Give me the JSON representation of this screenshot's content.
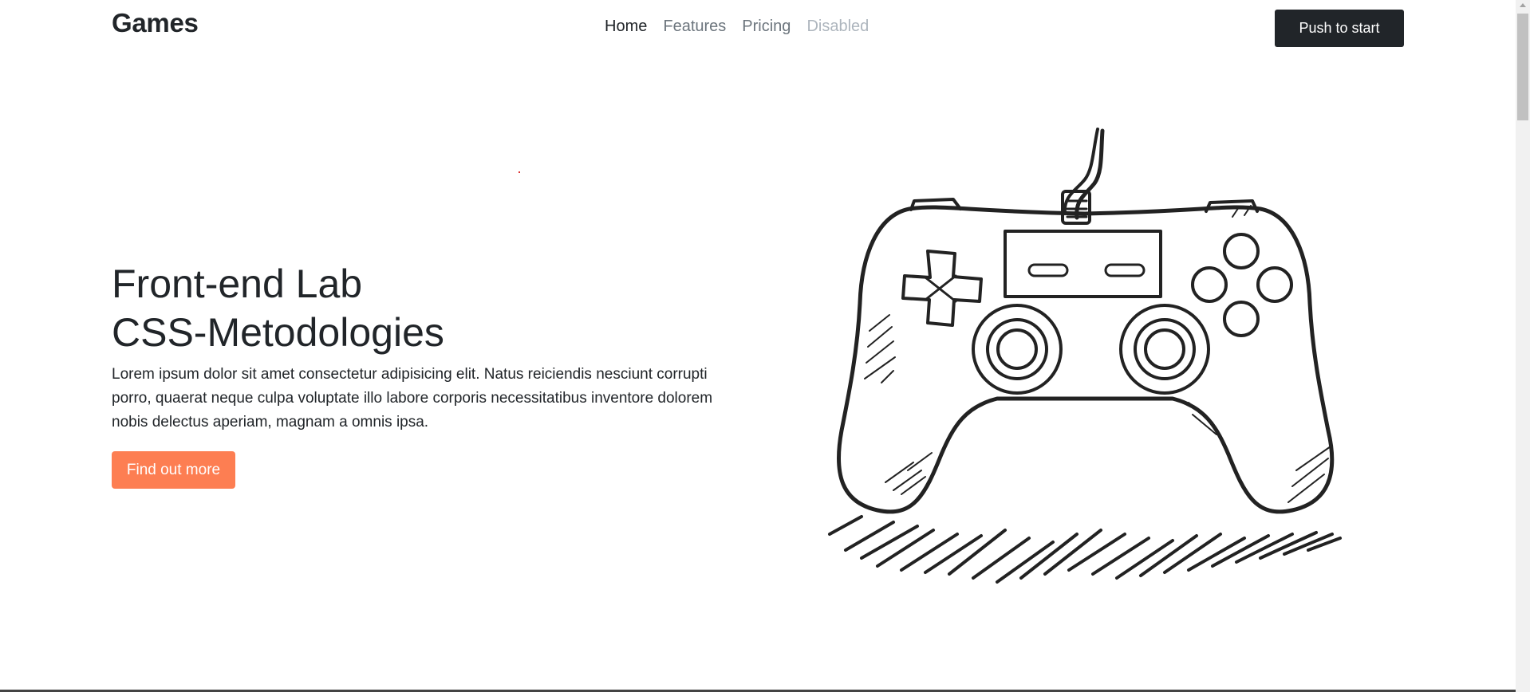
{
  "header": {
    "brand": "Games",
    "nav": [
      {
        "label": "Home",
        "state": "active"
      },
      {
        "label": "Features",
        "state": "normal"
      },
      {
        "label": "Pricing",
        "state": "normal"
      },
      {
        "label": "Disabled",
        "state": "disabled"
      }
    ],
    "cta_label": "Push to start"
  },
  "hero": {
    "title_line1": "Front-end Lab",
    "title_line2": "CSS-Metodologies",
    "description": "Lorem ipsum dolor sit amet consectetur adipisicing elit. Natus reiciendis nesciunt corrupti porro, quaerat neque culpa voluptate illo labore corporis necessitatibus inventore dolorem nobis delectus aperiam, magnam a omnis ipsa.",
    "button_label": "Find out more",
    "illustration_icon": "gamepad-icon"
  },
  "colors": {
    "accent": "#fd7e52",
    "dark": "#212529",
    "muted": "#6c757d",
    "disabled": "#adb5bd"
  }
}
